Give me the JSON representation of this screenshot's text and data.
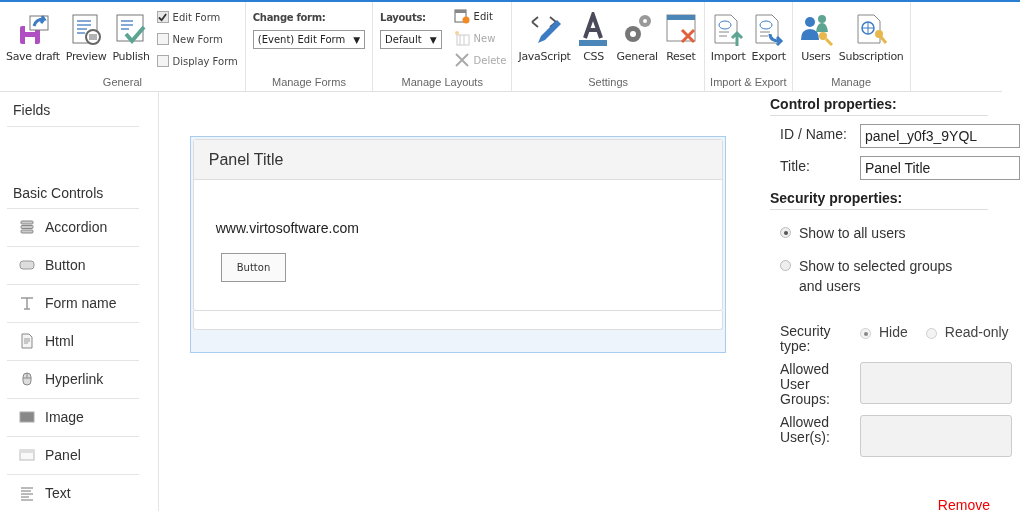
{
  "ribbon": {
    "groups": [
      {
        "label": "General",
        "items": [
          {
            "kind": "big",
            "label": "Save draft"
          },
          {
            "kind": "big",
            "label": "Preview"
          },
          {
            "kind": "big",
            "label": "Publish"
          },
          {
            "kind": "checks",
            "options": [
              {
                "label": "Edit Form",
                "checked": true
              },
              {
                "label": "New Form",
                "checked": false
              },
              {
                "label": "Display Form",
                "checked": false
              }
            ]
          }
        ]
      },
      {
        "label": "Manage Forms",
        "items": [
          {
            "kind": "select",
            "caption": "Change form:",
            "value": "(Event) Edit Form",
            "arrow": "▼"
          }
        ]
      },
      {
        "label": "Manage Layouts",
        "items": [
          {
            "kind": "select",
            "caption": "Layouts:",
            "value": "Default",
            "arrow": "▼"
          },
          {
            "kind": "smalls",
            "buttons": [
              {
                "label": "Edit",
                "disabled": false
              },
              {
                "label": "New",
                "disabled": true
              },
              {
                "label": "Delete",
                "disabled": true
              }
            ]
          }
        ]
      },
      {
        "label": "Settings",
        "items": [
          {
            "kind": "big",
            "label": "JavaScript"
          },
          {
            "kind": "big",
            "label": "CSS"
          },
          {
            "kind": "big",
            "label": "General"
          },
          {
            "kind": "big",
            "label": "Reset"
          }
        ]
      },
      {
        "label": "Import & Export",
        "items": [
          {
            "kind": "big",
            "label": "Import"
          },
          {
            "kind": "big",
            "label": "Export"
          }
        ]
      },
      {
        "label": "Manage",
        "items": [
          {
            "kind": "big",
            "label": "Users"
          },
          {
            "kind": "big",
            "label": "Subscription"
          }
        ]
      }
    ]
  },
  "sidebar": {
    "fields_title": "Fields",
    "controls_title": "Basic Controls",
    "items": [
      "Accordion",
      "Button",
      "Form name",
      "Html",
      "Hyperlink",
      "Image",
      "Panel",
      "Text"
    ]
  },
  "canvas": {
    "panel_title": "Panel Title",
    "text": "www.virtosoftware.com",
    "button": "Button"
  },
  "properties": {
    "control_title": "Control properties:",
    "fields": [
      {
        "label": "ID / Name:",
        "value": "panel_y0f3_9YQL"
      },
      {
        "label": "Title:",
        "value": "Panel Title"
      }
    ],
    "security_title": "Security properties:",
    "show_options": [
      {
        "label": "Show to all users",
        "selected": true
      },
      {
        "label": "Show to selected groups and users",
        "selected": false
      }
    ],
    "security_type": {
      "label": "Security type:",
      "disabled": true,
      "options": [
        {
          "label": "Hide",
          "selected": true
        },
        {
          "label": "Read-only",
          "selected": false
        }
      ]
    },
    "allowed": [
      {
        "label": "Allowed User Groups:"
      },
      {
        "label": "Allowed User(s):"
      }
    ],
    "remove": "Remove"
  }
}
